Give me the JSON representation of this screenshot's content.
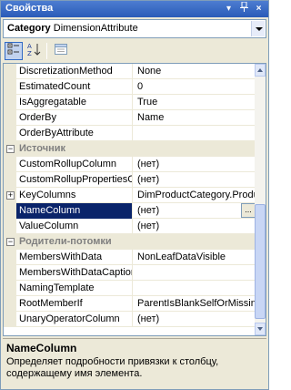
{
  "window": {
    "title": "Свойства",
    "buttons": {
      "dropdown": "▾",
      "pin": "ᵩ",
      "close": "×"
    }
  },
  "object_selector": {
    "kind": "Category",
    "name": "DimensionAttribute"
  },
  "toolbar": {
    "buttons": [
      {
        "name": "categorized",
        "active": true
      },
      {
        "name": "alphabetical",
        "active": false
      },
      {
        "name": "property-pages",
        "active": false
      }
    ]
  },
  "grid": {
    "rows": [
      {
        "type": "prop",
        "name": "DiscretizationMethod",
        "value": "None"
      },
      {
        "type": "prop",
        "name": "EstimatedCount",
        "value": "0"
      },
      {
        "type": "prop",
        "name": "IsAggregatable",
        "value": "True"
      },
      {
        "type": "prop",
        "name": "OrderBy",
        "value": "Name"
      },
      {
        "type": "prop",
        "name": "OrderByAttribute",
        "value": ""
      },
      {
        "type": "category",
        "name": "Источник",
        "expander": "−"
      },
      {
        "type": "prop",
        "name": "CustomRollupColumn",
        "value": "(нет)"
      },
      {
        "type": "prop",
        "name": "CustomRollupPropertiesCo",
        "value": "(нет)"
      },
      {
        "type": "prop",
        "name": "KeyColumns",
        "value": "DimProductCategory.Produ",
        "expander": "+"
      },
      {
        "type": "prop",
        "name": "NameColumn",
        "value": "(нет)",
        "selected": true,
        "ellipsis": "..."
      },
      {
        "type": "prop",
        "name": "ValueColumn",
        "value": "(нет)"
      },
      {
        "type": "category",
        "name": "Родители-потомки",
        "expander": "−"
      },
      {
        "type": "prop",
        "name": "MembersWithData",
        "value": "NonLeafDataVisible"
      },
      {
        "type": "prop",
        "name": "MembersWithDataCaption",
        "value": ""
      },
      {
        "type": "prop",
        "name": "NamingTemplate",
        "value": ""
      },
      {
        "type": "prop",
        "name": "RootMemberIf",
        "value": "ParentIsBlankSelfOrMissing"
      },
      {
        "type": "prop",
        "name": "UnaryOperatorColumn",
        "value": "(нет)"
      }
    ]
  },
  "description": {
    "title": "NameColumn",
    "text": "Определяет подробности привязки к столбцу, содержащему имя элемента."
  }
}
